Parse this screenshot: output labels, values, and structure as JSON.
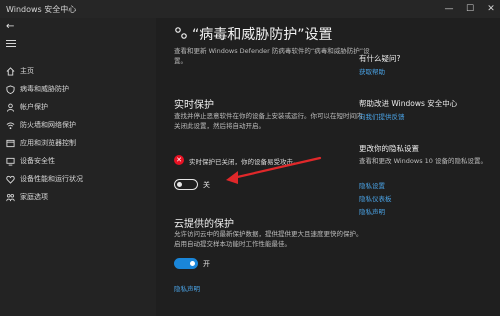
{
  "window": {
    "title": "Windows 安全中心",
    "controls": {
      "minimize": "—",
      "maximize": "☐",
      "close": "✕"
    }
  },
  "sidebar": {
    "back_glyph": "←",
    "items": [
      {
        "label": "主页",
        "icon": "home-icon"
      },
      {
        "label": "病毒和威胁防护",
        "icon": "shield-icon"
      },
      {
        "label": "帐户保护",
        "icon": "person-icon"
      },
      {
        "label": "防火墙和网络保护",
        "icon": "wifi-icon"
      },
      {
        "label": "应用和浏览器控制",
        "icon": "app-window-icon"
      },
      {
        "label": "设备安全性",
        "icon": "device-icon"
      },
      {
        "label": "设备性能和运行状况",
        "icon": "heart-icon"
      },
      {
        "label": "家庭选项",
        "icon": "family-icon"
      }
    ]
  },
  "main": {
    "title": "“病毒和威胁防护”设置",
    "intro": "查看和更新 Windows Defender 防病毒软件的“病毒和威胁防护”设置。",
    "realtime": {
      "heading": "实时保护",
      "description": "查找并停止恶意软件在你的设备上安装或运行。你可以在短时间内关闭此设置，然后将自动开启。",
      "warning": "实时保护已关闭，你的设备易受攻击。",
      "warning_glyph": "✕",
      "toggle_label": "关",
      "toggle_state": "off"
    },
    "cloud": {
      "heading": "云提供的保护",
      "description": "允许访问云中的最新保护数据，提供提供更大且速度更快的保护。启用自动提交样本功能时工作性能最佳。",
      "toggle_label": "开",
      "toggle_state": "on",
      "privacy_link": "隐私声明"
    }
  },
  "right": {
    "question": {
      "heading": "有什么疑问?",
      "link": "获取帮助"
    },
    "improve": {
      "heading": "帮助改进 Windows 安全中心",
      "link": "向我们提供反馈"
    },
    "privacy": {
      "heading": "更改你的隐私设置",
      "text": "查看和更改 Windows 10 设备的隐私设置。",
      "links": [
        "隐私设置",
        "隐私仪表板",
        "隐私声明"
      ]
    }
  },
  "colors": {
    "accent": "#1a86d9",
    "link": "#4aa3e6",
    "danger": "#e81123",
    "annotation": "#e0282a"
  }
}
